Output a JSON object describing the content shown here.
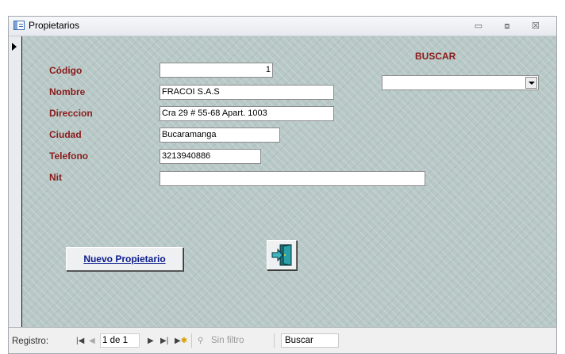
{
  "window": {
    "title": "Propietarios",
    "controls": {
      "minimize": "▭",
      "maximize": "⧈",
      "close": "☒"
    }
  },
  "form": {
    "fields": [
      {
        "label": "Código",
        "value": "1"
      },
      {
        "label": "Nombre",
        "value": "FRACOI S.A.S"
      },
      {
        "label": "Direccion",
        "value": "Cra 29 # 55-68 Apart. 1003"
      },
      {
        "label": "Ciudad",
        "value": "Bucaramanga"
      },
      {
        "label": "Telefono",
        "value": "3213940886"
      },
      {
        "label": "Nit",
        "value": ""
      }
    ],
    "search_label": "BUSCAR",
    "search_combo_value": "",
    "nuevo_button_label": "Nuevo Propietario",
    "exit_button_icon": "exit-door-icon"
  },
  "navigation": {
    "label": "Registro:",
    "record_display": "1 de 1",
    "filter_status": "Sin filtro",
    "search_placeholder": "Buscar",
    "icons": [
      "first-record-icon",
      "previous-record-icon",
      "next-record-icon",
      "last-record-icon",
      "new-record-icon",
      "filter-icon"
    ]
  },
  "colors": {
    "label_color": "#8b1a1a",
    "button_text_color": "#0a1a8c",
    "form_background": "#b7c8c6"
  }
}
